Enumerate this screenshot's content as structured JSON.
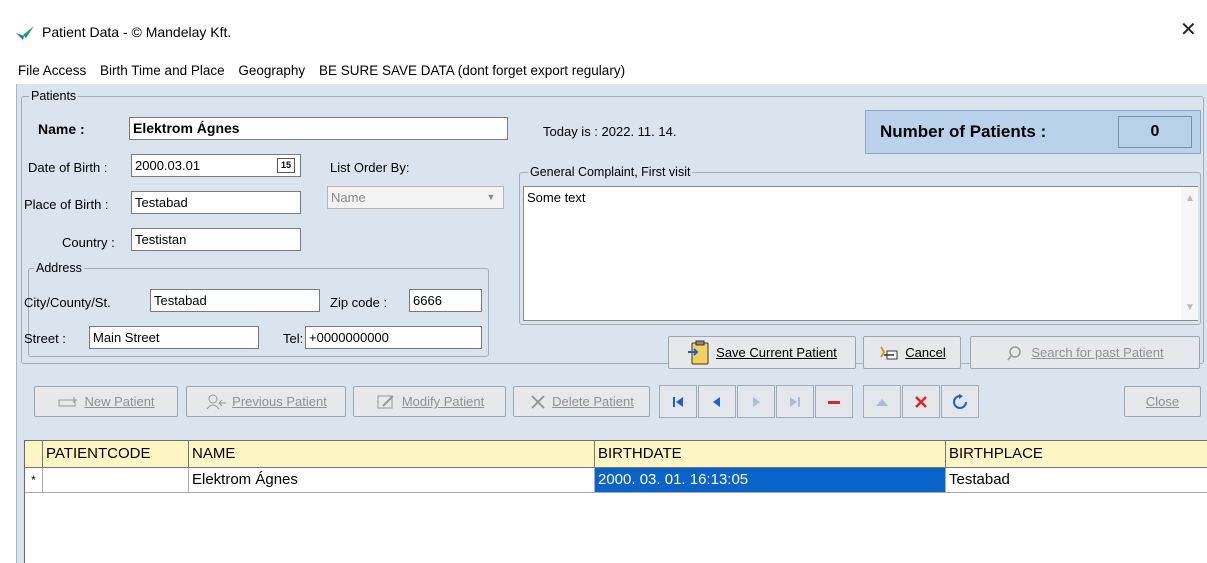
{
  "window": {
    "title": "Patient Data - © Mandelay Kft.",
    "close_glyph": "✕"
  },
  "menu": [
    "File Access",
    "Birth Time and Place",
    "Geography",
    "BE SURE SAVE DATA (dont forget export regulary)"
  ],
  "patients_group": {
    "title": "Patients",
    "name_label": "Name :",
    "name_value": "Elektrom Ágnes",
    "dob_label": "Date of Birth :",
    "dob_value": "2000.03.01",
    "calendar_glyph": "15",
    "pob_label": "Place of Birth :",
    "pob_value": "Testabad",
    "country_label": "Country :",
    "country_value": "Testistan",
    "list_order_label": "List Order By:",
    "list_order_value": "Name",
    "today_label": "Today is :  2022. 11. 14."
  },
  "patient_count": {
    "label": "Number of Patients :",
    "value": "0"
  },
  "address_group": {
    "title": "Address",
    "city_label": "City/County/St.",
    "city_value": "Testabad",
    "zip_label": "Zip code :",
    "zip_value": "6666",
    "street_label": "Street :",
    "street_value": "Main Street",
    "tel_label": "Tel:",
    "tel_value": "+0000000000"
  },
  "complaint_group": {
    "title": "General Complaint, First visit",
    "text": "Some text"
  },
  "actions": {
    "save": "Save Current Patient",
    "cancel": "Cancel",
    "search": "Search for past Patient",
    "new": "New Patient",
    "previous": "Previous Patient",
    "modify": "Modify Patient",
    "delete": "Delete Patient",
    "close": "Close"
  },
  "grid": {
    "columns": [
      "PATIENTCODE",
      "NAME",
      "BIRTHDATE",
      "BIRTHPLACE"
    ],
    "rows": [
      {
        "indicator": "*",
        "patientcode": "",
        "name": "Elektrom Ágnes",
        "birthdate": "2000. 03. 01. 16:13:05",
        "birthplace": "Testabad"
      }
    ]
  },
  "colors": {
    "client_bg": "#dae4ee",
    "counter_bg": "#b9d1ea",
    "grid_header_bg": "#fdf5c4",
    "selected_cell_bg": "#0a63c9",
    "nav_blue": "#1e5fd0",
    "delete_red": "#d42a2a"
  }
}
